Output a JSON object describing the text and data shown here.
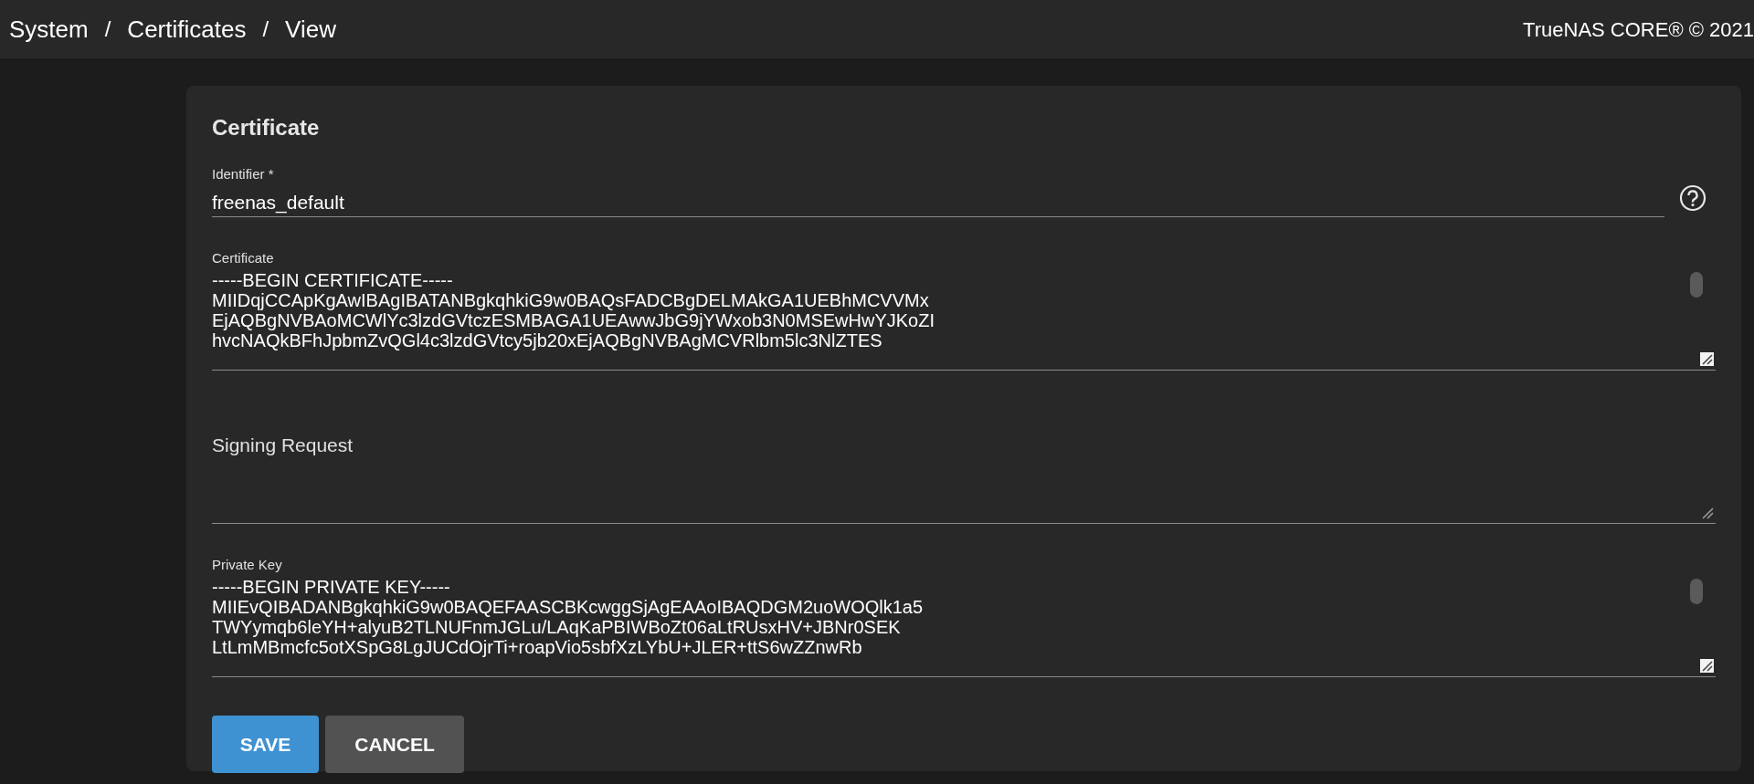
{
  "top_bar": {
    "breadcrumb": [
      "System",
      "/",
      "Certificates",
      "/",
      "View"
    ],
    "product": "TrueNAS CORE® © 2021"
  },
  "form": {
    "title": "Certificate",
    "fields": [
      {
        "kind": "input",
        "label": "Identifier *",
        "value": "freenas_default",
        "help": true
      },
      {
        "kind": "textarea",
        "label": "Certificate",
        "lines": [
          "-----BEGIN CERTIFICATE-----",
          "MIIDqjCCApKgAwIBAgIBATANBgkqhkiG9w0BAQsFADCBgDELMAkGA1UEBhMCVVMx",
          "EjAQBgNVBAoMCWlYc3lzdGVtczESMBAGA1UEAwwJbG9jYWxob3N0MSEwHwYJKoZI",
          "hvcNAQkBFhJpbmZvQGl4c3lzdGVtcy5jb20xEjAQBgNVBAgMCVRlbm5lc3NlZTES"
        ]
      },
      {
        "kind": "textarea",
        "placeholder": "Signing Request"
      },
      {
        "kind": "textarea",
        "label": "Private Key",
        "lines": [
          "-----BEGIN PRIVATE KEY-----",
          "MIIEvQIBADANBgkqhkiG9w0BAQEFAASCBKcwggSjAgEAAoIBAQDGM2uoWOQlk1a5",
          "TWYymqb6leYH+alyuB2TLNUFnmJGLu/LAqKaPBIWBoZt06aLtRUsxHV+JBNr0SEK",
          "LtLmMBmcfc5otXSpG8LgJUCdOjrTi+roapVio5sbfXzLYbU+JLER+ttS6wZZnwRb"
        ]
      }
    ],
    "buttons": [
      {
        "label": "SAVE",
        "kind": "primary"
      },
      {
        "label": "CANCEL",
        "kind": "secondary"
      }
    ]
  }
}
